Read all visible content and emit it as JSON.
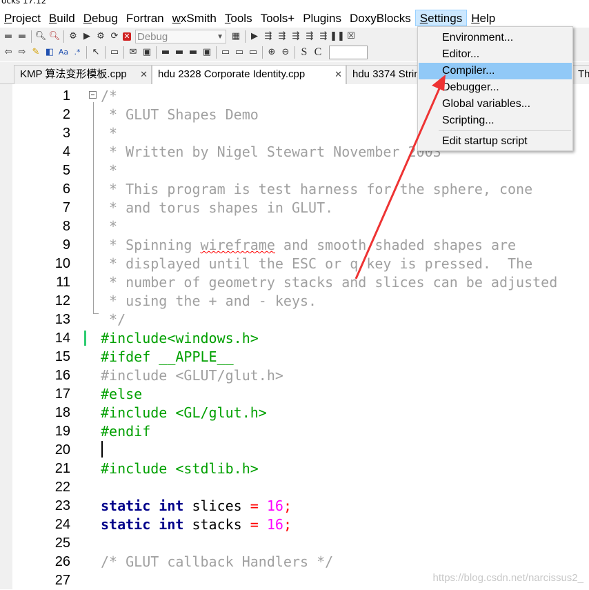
{
  "window": {
    "title_fragment": "ocks 17.12"
  },
  "menubar": [
    {
      "label": "Project",
      "underline": "P",
      "rest": "roject"
    },
    {
      "label": "Build",
      "underline": "B",
      "rest": "uild"
    },
    {
      "label": "Debug",
      "underline": "D",
      "rest": "ebug"
    },
    {
      "label": "Fortran",
      "underline": "",
      "rest": "Fortran"
    },
    {
      "label": "wxSmith",
      "underline": "w",
      "rest": "xSmith"
    },
    {
      "label": "Tools",
      "underline": "T",
      "rest": "ools"
    },
    {
      "label": "Tools+",
      "underline": "",
      "rest": "Tools+"
    },
    {
      "label": "Plugins",
      "underline": "",
      "rest": "Plugins"
    },
    {
      "label": "DoxyBlocks",
      "underline": "",
      "rest": "DoxyBlocks"
    },
    {
      "label": "Settings",
      "underline": "S",
      "rest": "ettings"
    },
    {
      "label": "Help",
      "underline": "H",
      "rest": "elp"
    }
  ],
  "toolbar": {
    "build_target": "Debug"
  },
  "tabs": [
    {
      "label": "KMP 算法变形模板.cpp"
    },
    {
      "label": "hdu 2328 Corporate Identity.cpp"
    },
    {
      "label": "hdu 3374 Strin"
    },
    {
      "label": "Th"
    }
  ],
  "settings_menu": [
    {
      "label": "Environment..."
    },
    {
      "label": "Editor..."
    },
    {
      "label": "Compiler..."
    },
    {
      "label": "Debugger..."
    },
    {
      "label": "Global variables..."
    },
    {
      "label": "Scripting..."
    },
    {
      "label": "Edit startup script"
    }
  ],
  "line_numbers": [
    "1",
    "2",
    "3",
    "4",
    "5",
    "6",
    "7",
    "8",
    "9",
    "10",
    "11",
    "12",
    "13",
    "14",
    "15",
    "16",
    "17",
    "18",
    "19",
    "20",
    "21",
    "22",
    "23",
    "24",
    "25",
    "26",
    "27"
  ],
  "code": {
    "l1": "/*",
    "l2": " * GLUT Shapes Demo",
    "l3": " *",
    "l4": " * Written by Nigel Stewart November 2003",
    "l5": " *",
    "l6": " * This program is test harness for the sphere, cone",
    "l7": " * and torus shapes in GLUT.",
    "l8": " *",
    "l9a": " * Spinning ",
    "l9b": "wireframe",
    "l9c": " and smooth shaded shapes are",
    "l10": " * displayed until the ESC or q key is pressed.  The",
    "l11": " * number of geometry stacks and slices can be adjusted",
    "l12": " * using the + and - keys.",
    "l13": " */",
    "l14": "#include<windows.h>",
    "l15": "#ifdef __APPLE__",
    "l16": "#include <GLUT/glut.h>",
    "l17": "#else",
    "l18": "#include <GL/glut.h>",
    "l19": "#endif",
    "l20": "",
    "l21": "#include <stdlib.h>",
    "l22": "",
    "l23_kw1": "static",
    "l23_kw2": "int",
    "l23_id": "slices",
    "l23_op": "=",
    "l23_num": "16",
    "l23_end": ";",
    "l24_kw1": "static",
    "l24_kw2": "int",
    "l24_id": "stacks",
    "l24_op": "=",
    "l24_num": "16",
    "l24_end": ";",
    "l25": "",
    "l26": "/* GLUT callback Handlers */",
    "l27": ""
  },
  "watermark": "https://blog.csdn.net/narcissus2_",
  "colors": {
    "comment": "#a0a0a0",
    "preprocessor": "#00a000",
    "keyword": "#00008b",
    "number": "#ff00ff",
    "operator": "#ff0000",
    "menu_highlight": "#91c9f7",
    "annotation_arrow": "#ee3333"
  },
  "icons": [
    "open-icon",
    "save-icon",
    "find-icon",
    "replace-icon",
    "build-icon",
    "run-icon",
    "build-run-icon",
    "rebuild-icon",
    "abort-icon",
    "debug-run-icon",
    "step-icon",
    "pause-icon",
    "stop-icon"
  ]
}
